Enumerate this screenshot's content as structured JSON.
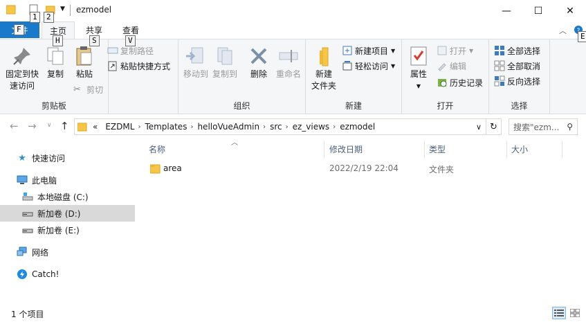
{
  "window": {
    "title": "ezmodel",
    "minimize": "—",
    "maximize": "☐",
    "close": "✕"
  },
  "keytips": {
    "qa1": "1",
    "qa2": "2",
    "file": "F",
    "home": "H",
    "share": "S",
    "view": "V",
    "help": "E"
  },
  "tabs": {
    "file": "文件",
    "home": "主页",
    "share": "共享",
    "view": "查看"
  },
  "ribbon": {
    "clipboard": {
      "label": "剪贴板",
      "pin": [
        "固定到快",
        "速访问"
      ],
      "copy": "复制",
      "paste": "粘贴",
      "copy_path": "复制路径",
      "paste_shortcut": "粘贴快捷方式",
      "cut": "剪切"
    },
    "organize": {
      "label": "组织",
      "move_to": "移动到",
      "copy_to": "复制到",
      "delete": "删除",
      "rename": "重命名"
    },
    "new": {
      "label": "新建",
      "new_item": "新建项目",
      "easy_access": "轻松访问",
      "new_folder": [
        "新建",
        "文件夹"
      ]
    },
    "open": {
      "label": "打开",
      "properties": "属性",
      "open": "打开",
      "edit": "编辑",
      "history": "历史记录"
    },
    "select": {
      "label": "选择",
      "select_all": "全部选择",
      "select_none": "全部取消",
      "invert": "反向选择"
    }
  },
  "address": {
    "prefix": "«",
    "crumbs": [
      "EZDML",
      "Templates",
      "helloVueAdmin",
      "src",
      "ez_views",
      "ezmodel"
    ]
  },
  "search": {
    "placeholder": "搜索\"ezm..."
  },
  "navpane": {
    "quick_access": "快速访问",
    "this_pc": "此电脑",
    "drive_c": "本地磁盘 (C:)",
    "drive_d": "新加卷 (D:)",
    "drive_e": "新加卷 (E:)",
    "network": "网络",
    "catch": "Catch!"
  },
  "columns": {
    "name": "名称",
    "date": "修改日期",
    "type": "类型",
    "size": "大小"
  },
  "files": [
    {
      "name": "area",
      "date": "2022/2/19 22:04",
      "type": "文件夹",
      "size": ""
    }
  ],
  "status": {
    "count": "1 个项目"
  },
  "colors": {
    "accent": "#1979ca",
    "folder": "#f8c646",
    "selection": "#d9d9d9"
  }
}
